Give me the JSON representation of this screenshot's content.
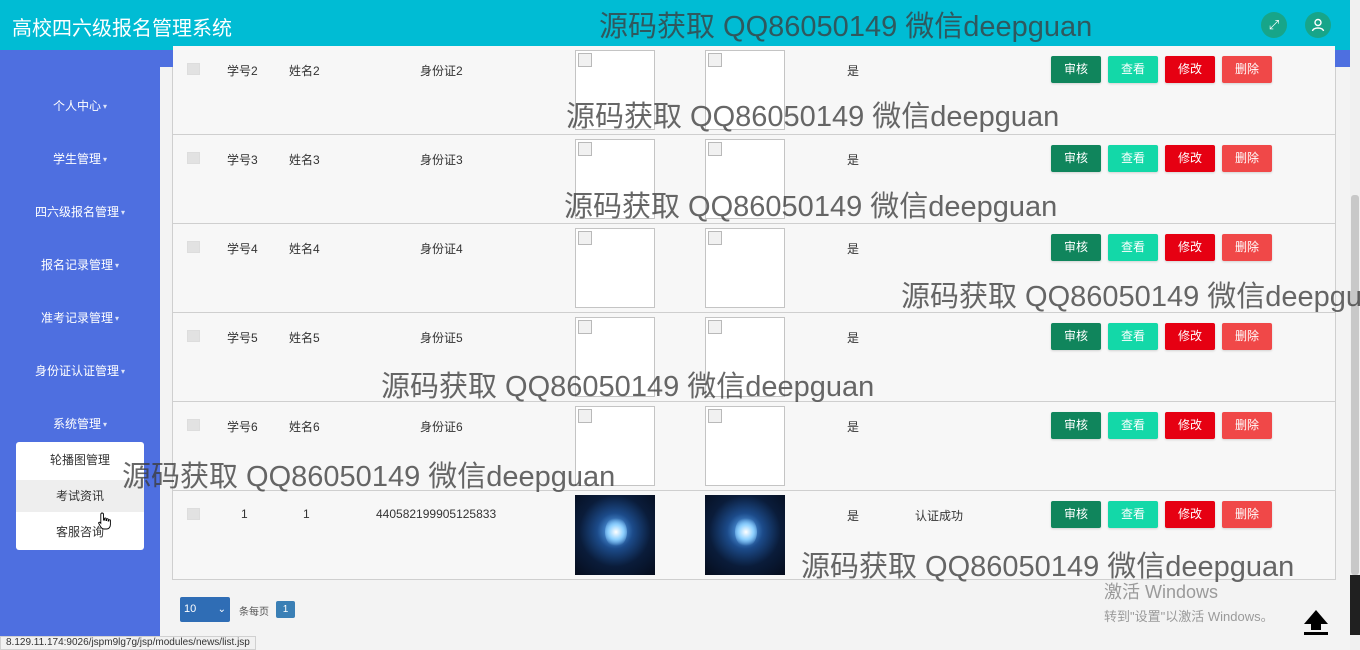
{
  "header": {
    "title": "高校四六级报名管理系统",
    "fullscreen_icon": "fullscreen-icon",
    "user_icon": "user-icon"
  },
  "sidebar": {
    "items": [
      {
        "label": "个人中心"
      },
      {
        "label": "学生管理"
      },
      {
        "label": "四六级报名管理"
      },
      {
        "label": "报名记录管理"
      },
      {
        "label": "准考记录管理"
      },
      {
        "label": "身份证认证管理"
      },
      {
        "label": "系统管理"
      }
    ],
    "submenu": [
      {
        "label": "轮播图管理"
      },
      {
        "label": "考试资讯"
      },
      {
        "label": "客服咨询"
      }
    ]
  },
  "table": {
    "rows": [
      {
        "student_no": "学号2",
        "name": "姓名2",
        "id_card": "身份证2",
        "flag": "是",
        "status": "",
        "photo": false
      },
      {
        "student_no": "学号3",
        "name": "姓名3",
        "id_card": "身份证3",
        "flag": "是",
        "status": "",
        "photo": false
      },
      {
        "student_no": "学号4",
        "name": "姓名4",
        "id_card": "身份证4",
        "flag": "是",
        "status": "",
        "photo": false
      },
      {
        "student_no": "学号5",
        "name": "姓名5",
        "id_card": "身份证5",
        "flag": "是",
        "status": "",
        "photo": false
      },
      {
        "student_no": "学号6",
        "name": "姓名6",
        "id_card": "身份证6",
        "flag": "是",
        "status": "",
        "photo": false
      },
      {
        "student_no": "1",
        "name": "1",
        "id_card": "440582199905125833",
        "flag": "是",
        "status": "认证成功",
        "photo": true
      }
    ],
    "actions": {
      "audit": "审核",
      "view": "查看",
      "edit": "修改",
      "delete": "删除"
    }
  },
  "pagination": {
    "page_size": "10",
    "per_page_label": "条每页",
    "current_page": "1"
  },
  "status_url": "8.129.11.174:9026/jspm9lg7g/jsp/modules/news/list.jsp",
  "windows_activation": {
    "line1": "激活 Windows",
    "line2": "转到\"设置\"以激活 Windows。"
  },
  "watermark": "源码获取 QQ86050149 微信deepguan",
  "colors": {
    "header": "#00bcd4",
    "sidebar": "#4e6fe0",
    "audit": "#10855c",
    "view": "#13d8a8",
    "edit": "#e60012",
    "delete": "#f04848"
  }
}
